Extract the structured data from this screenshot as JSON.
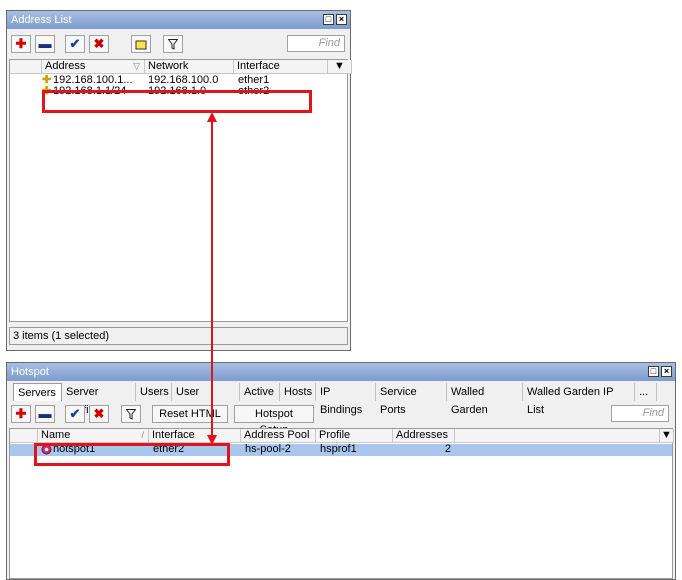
{
  "address_window": {
    "title": "Address List",
    "find_placeholder": "Find",
    "columns": [
      "Address",
      "Network",
      "Interface"
    ],
    "rows": [
      {
        "address": "192.168.100.1...",
        "network": "192.168.100.0",
        "interface": "ether1"
      },
      {
        "address": "192.168.1.1/24",
        "network": "192.168.1.0",
        "interface": "ether2"
      }
    ],
    "status": "3 items (1 selected)"
  },
  "hotspot_window": {
    "title": "Hotspot",
    "tabs": [
      "Servers",
      "Server Profiles",
      "Users",
      "User Profiles",
      "Active",
      "Hosts",
      "IP Bindings",
      "Service Ports",
      "Walled Garden",
      "Walled Garden IP List",
      "..."
    ],
    "reset_html_label": "Reset HTML",
    "hotspot_setup_label": "Hotspot Setup",
    "find_placeholder": "Find",
    "columns": [
      "Name",
      "Interface",
      "Address Pool",
      "Profile",
      "Addresses ..."
    ],
    "rows": [
      {
        "name": "hotspot1",
        "interface": "ether2",
        "address_pool": "hs-pool-2",
        "profile": "hsprof1",
        "addresses": "2"
      }
    ]
  },
  "colors": {
    "highlight": "#e0141b",
    "selected_row": "#a9c7ec",
    "title_bar": "#8aa6d6"
  }
}
